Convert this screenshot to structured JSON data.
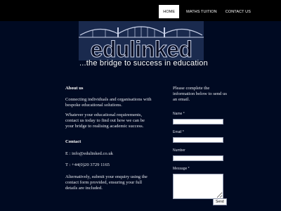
{
  "nav": {
    "items": [
      {
        "label": "HOME",
        "active": true
      },
      {
        "label": "MATHS TUITION",
        "active": false
      },
      {
        "label": "CONTACT US",
        "active": false
      }
    ]
  },
  "brand": {
    "logo_text": "edulinked",
    "tagline": "...the bridge to success in education"
  },
  "about": {
    "heading": "About us",
    "para1": "Connecting individuals and organisations with bespoke educational solutions.",
    "para2": "Whatever your educational requirements, contact us today to find out how we can be your bridge to realising academic success."
  },
  "contact": {
    "heading": "Contact",
    "email": "E : info@edulinked.co.uk",
    "phone": "T : +44(0)20 3729 1165",
    "alt": "Alternatively, submit your enquiry using the contact form provided, ensuring your full details are included."
  },
  "form": {
    "intro": "Please complete the information below to send us an email.",
    "name_label": "Name *",
    "email_label": "Email *",
    "number_label": "Number",
    "message_label": "Message *",
    "send_label": "Send"
  },
  "colors": {
    "background": "#000a22",
    "topbar": "#000000",
    "logo_outline": "#c9d1e8"
  }
}
